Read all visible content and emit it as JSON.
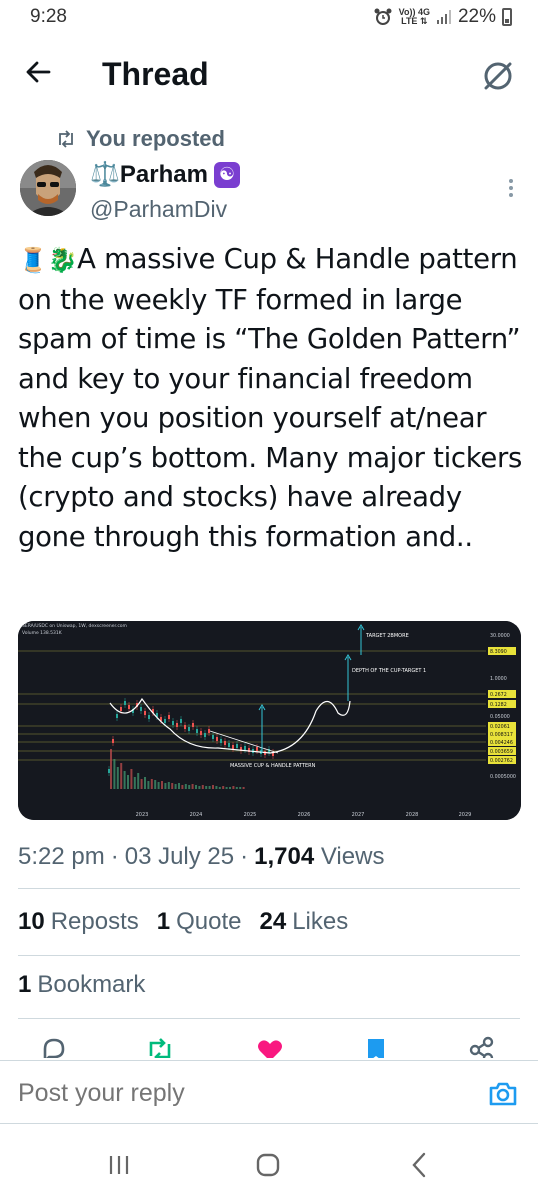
{
  "status_bar": {
    "time": "9:28",
    "network_top": "Vo)) 4G",
    "network_bottom": "LTE ⇅",
    "battery": "22%"
  },
  "header": {
    "title": "Thread"
  },
  "repost": {
    "label": "You reposted"
  },
  "author": {
    "name": "⚖️Parham",
    "badge": "☯",
    "handle": "@ParhamDiv"
  },
  "tweet": {
    "emoji": "🧵🐉",
    "text": "A massive Cup & Handle pattern on the weekly TF formed in large spam of time is “The Golden Pattern” and key to your financial freedom when you position yourself at/near the cup’s bottom. Many major tickers (crypto and stocks) have already gone through this formation and.."
  },
  "chart": {
    "ticker": "SERA/USDC on Uniswap, 1W, dexscreener.com",
    "volume": "Volume  138.531K",
    "annotation_target": "TARGET 2BMORE",
    "annotation_depth": "DEPTH OF THE CUP-TARGET 1",
    "annotation_pattern": "MASSIVE CUP & HANDLE PATTERN",
    "x_labels": [
      "2023",
      "2024",
      "2025",
      "2026",
      "2027",
      "2028",
      "2029"
    ],
    "price_labels": [
      "30.0000",
      "8.3090",
      "1.0000",
      "0.2672",
      "0.1282",
      "0.05000",
      "0.02061",
      "0.008317",
      "0.004246",
      "0.003659",
      "0.002762",
      "0.0005000"
    ],
    "highlighted_prices": [
      "8.3090",
      "0.2672",
      "0.1282",
      "0.02061",
      "0.008317",
      "0.004246",
      "0.003659",
      "0.002762"
    ]
  },
  "meta": {
    "time": "5:22 pm",
    "date": "03 July 25",
    "views_count": "1,704",
    "views_label": "Views"
  },
  "stats": {
    "reposts_count": "10",
    "reposts_label": "Reposts",
    "quotes_count": "1",
    "quotes_label": "Quote",
    "likes_count": "24",
    "likes_label": "Likes",
    "bookmarks_count": "1",
    "bookmarks_label": "Bookmark"
  },
  "reply": {
    "placeholder": "Post your reply"
  },
  "colors": {
    "repost_green": "#00ba7c",
    "like_pink": "#f91880",
    "bookmark_blue": "#1d9bf0",
    "text_secondary": "#536471"
  }
}
